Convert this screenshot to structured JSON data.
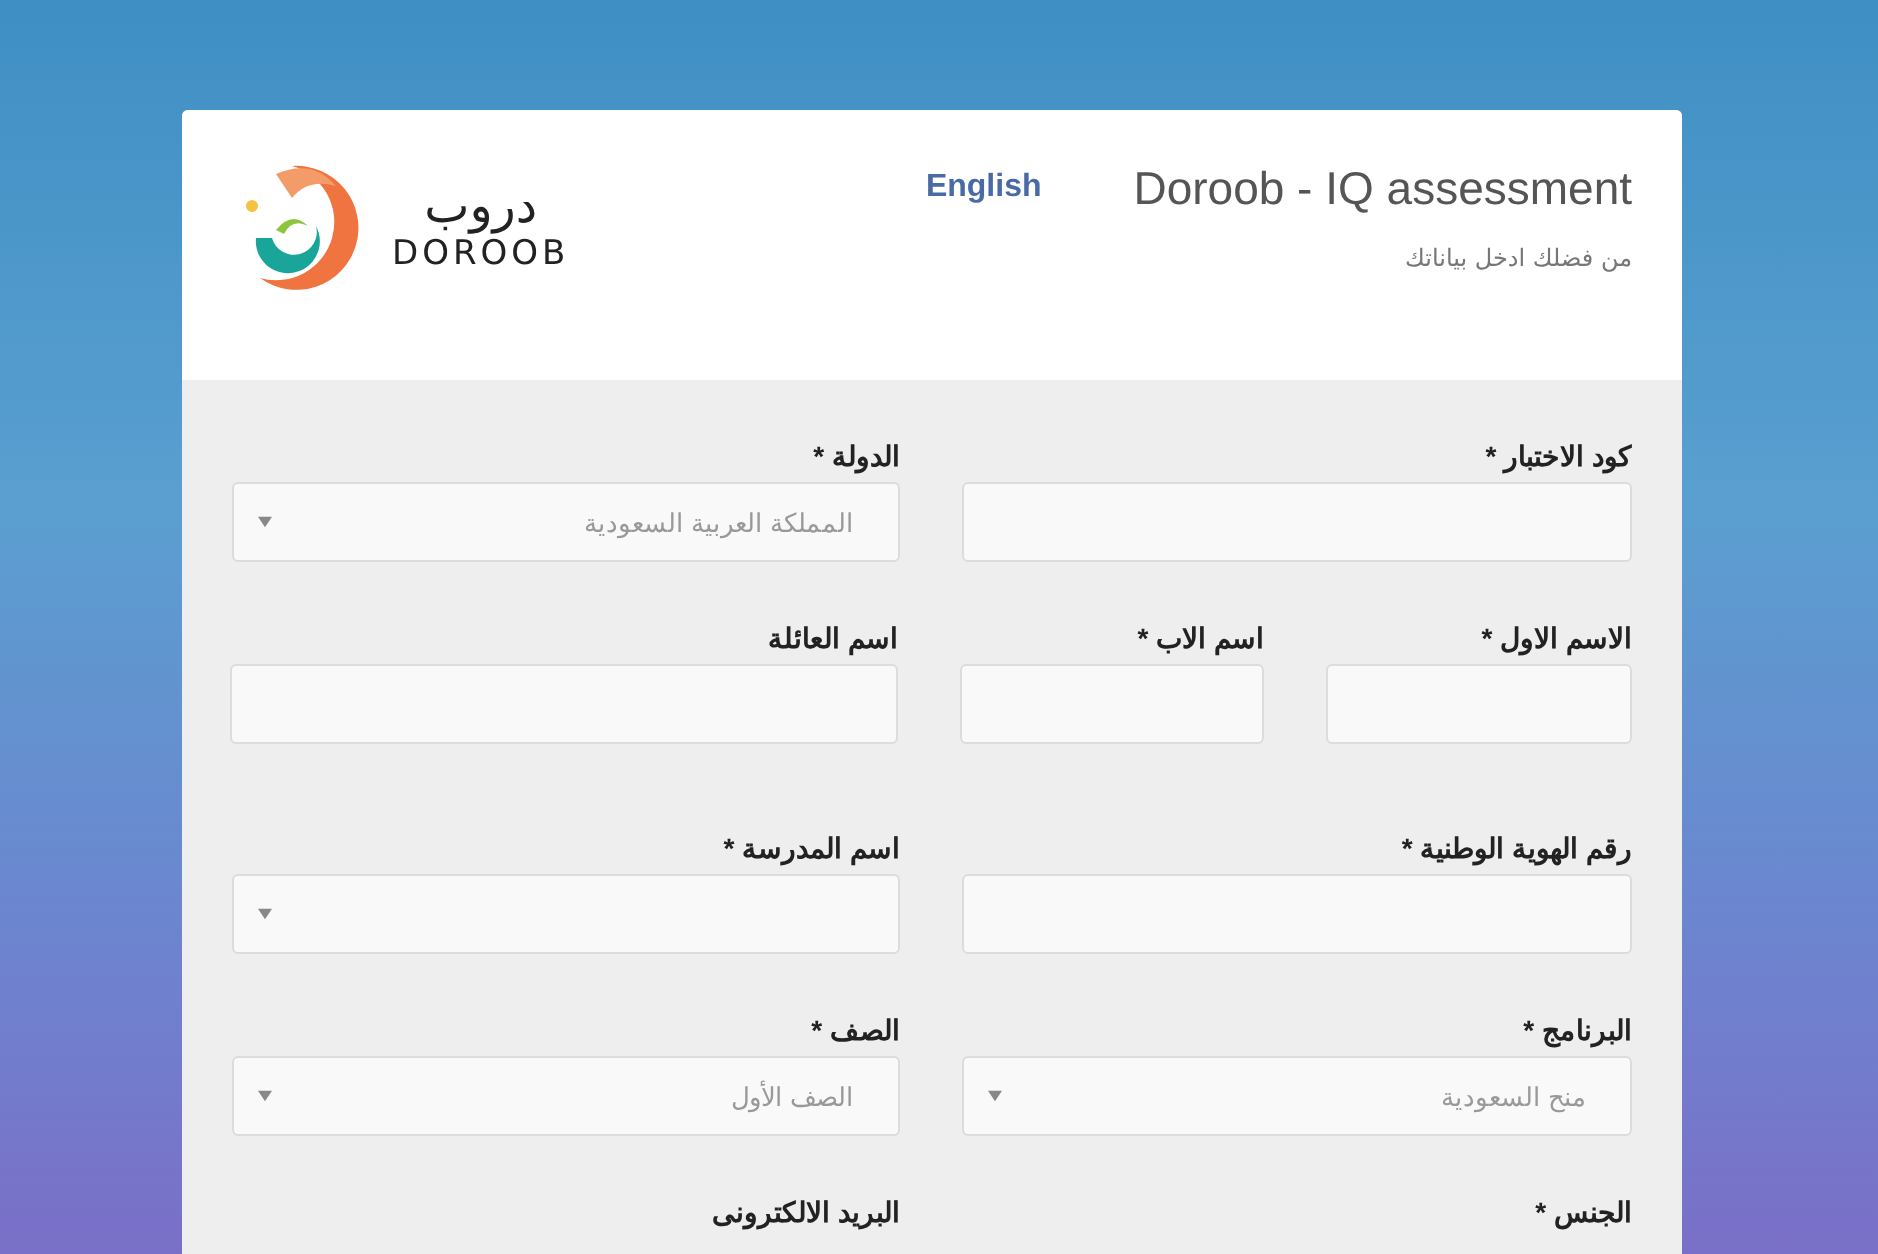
{
  "header": {
    "logo": {
      "arabic": "دروب",
      "latin": "DOROOB"
    },
    "language_link": "English",
    "title": "Doroob - IQ assessment",
    "subtitle": "من فضلك ادخل بياناتك"
  },
  "form_rows": [
    [
      {
        "label": "كود الاختبار *",
        "kind": "text"
      },
      {
        "label": "الدولة *",
        "kind": "select",
        "value": "المملكة العربية السعودية"
      }
    ],
    [
      {
        "label": "الاسم الاول *",
        "kind": "text"
      },
      {
        "label": "اسم الاب *",
        "kind": "text"
      },
      {
        "label": "اسم العائلة",
        "kind": "text"
      }
    ],
    [
      {
        "label": "رقم الهوية الوطنية *",
        "kind": "text"
      },
      {
        "label": "اسم المدرسة *",
        "kind": "select"
      }
    ],
    [
      {
        "label": "البرنامج *",
        "kind": "select",
        "value": "منح السعودية"
      },
      {
        "label": "الصف *",
        "kind": "select",
        "value": "الصف الأول"
      }
    ],
    [
      {
        "label": "الجنس *"
      },
      {
        "label": "البريد الالكترونى"
      }
    ]
  ]
}
